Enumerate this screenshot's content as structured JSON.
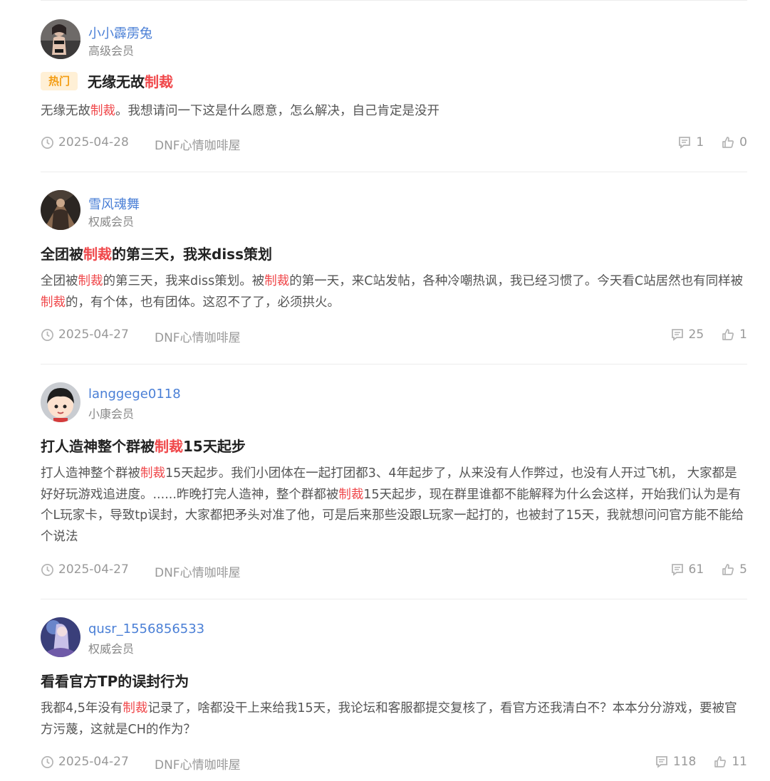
{
  "colors": {
    "accent": "#4a7fd6",
    "highlight": "#f0484b",
    "hot_bg": "#fff0d6",
    "hot_text": "#f39c12",
    "meta": "#999999"
  },
  "posts": [
    {
      "user": "小小霹雳兔",
      "level": "高级会员",
      "hot_label": "热门",
      "title_parts": [
        "无缘无故",
        "制裁",
        ""
      ],
      "body_parts": [
        "无缘无故",
        "制裁",
        "。我想请问一下这是什么愿意，怎么解决，自己肯定是没开"
      ],
      "date": "2025-04-28",
      "forum": "DNF心情咖啡屋",
      "comments": "1",
      "likes": "0"
    },
    {
      "user": "雪风魂舞",
      "level": "权威会员",
      "title_parts": [
        "全团被",
        "制裁",
        "的第三天，我来diss策划"
      ],
      "body_parts": [
        "全团被",
        "制裁",
        "的第三天，我来diss策划。被",
        "制裁",
        "的第一天，来C站发帖，各种冷嘲热讽，我已经习惯了。今天看C站居然也有同样被",
        "制裁",
        "的，有个体，也有团体。这忍不了了，必须拱火。"
      ],
      "date": "2025-04-27",
      "forum": "DNF心情咖啡屋",
      "comments": "25",
      "likes": "1"
    },
    {
      "user": "langgege0118",
      "level": "小康会员",
      "title_parts": [
        "打人造神整个群被",
        "制裁",
        "15天起步"
      ],
      "body_parts": [
        "打人造神整个群被",
        "制裁",
        "15天起步。我们小团体在一起打团都3、4年起步了，从来没有人作弊过，也没有人开过飞机， 大家都是好好玩游戏追进度。......昨晚打完人造神，整个群都被",
        "制裁",
        "15天起步，现在群里谁都不能解释为什么会这样，开始我们认为是有个L玩家卡，导致tp误封，大家都把矛头对准了他，可是后来那些没跟L玩家一起打的，也被封了15天，我就想问问官方能不能给个说法"
      ],
      "date": "2025-04-27",
      "forum": "DNF心情咖啡屋",
      "comments": "61",
      "likes": "5"
    },
    {
      "user": "qusr_1556856533",
      "level": "权威会员",
      "title_parts": [
        "看看官方TP的误封行为",
        "",
        ""
      ],
      "body_parts": [
        "我都4,5年没有",
        "制裁",
        "记录了，啥都没干上来给我15天，我论坛和客服都提交复核了，看官方还我清白不？本本分分游戏，要被官方污蔑，这就是CH的作为？"
      ],
      "date": "2025-04-27",
      "forum": "DNF心情咖啡屋",
      "comments": "118",
      "likes": "11"
    }
  ]
}
